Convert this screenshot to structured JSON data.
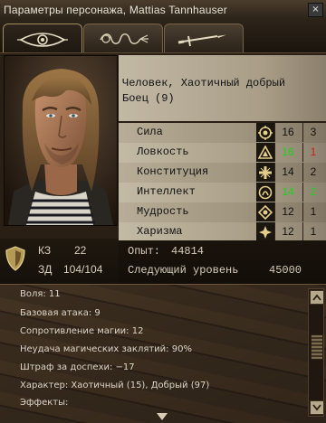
{
  "window": {
    "title": "Параметры персонажа, Mattias Tannhauser",
    "close_glyph": "×"
  },
  "tabs": [
    {
      "icon": "eye-icon",
      "active": true
    },
    {
      "icon": "rope-icon",
      "active": false
    },
    {
      "icon": "sword-icon",
      "active": false
    }
  ],
  "character": {
    "race_alignment": "Человек, Хаотичный добрый",
    "class_level": "Боец (9)"
  },
  "abilities": [
    {
      "name": "Сила",
      "icon": "strength-icon",
      "score": "16",
      "mod": "3",
      "score_color": "normal",
      "mod_color": "normal"
    },
    {
      "name": "Ловкость",
      "icon": "dexterity-icon",
      "score": "16",
      "mod": "1",
      "score_color": "green",
      "mod_color": "red"
    },
    {
      "name": "Конституция",
      "icon": "constitution-icon",
      "score": "14",
      "mod": "2",
      "score_color": "normal",
      "mod_color": "normal"
    },
    {
      "name": "Интеллект",
      "icon": "intelligence-icon",
      "score": "14",
      "mod": "2",
      "score_color": "green",
      "mod_color": "green"
    },
    {
      "name": "Мудрость",
      "icon": "wisdom-icon",
      "score": "12",
      "mod": "1",
      "score_color": "normal",
      "mod_color": "normal"
    },
    {
      "name": "Харизма",
      "icon": "charisma-icon",
      "score": "12",
      "mod": "1",
      "score_color": "normal",
      "mod_color": "normal"
    }
  ],
  "defense": {
    "ac_label": "КЗ",
    "ac_value": "22",
    "hp_label": "ЗД",
    "hp_value": "104/104"
  },
  "experience": {
    "xp_label": "Опыт:",
    "xp_value": "44814",
    "next_label": "Следующий уровень",
    "next_value": "45000"
  },
  "details": [
    "Воля: 11",
    "Базовая атака: 9",
    "Сопротивление магии: 12",
    "Неудача магических заклятий: 90%",
    "Штраф за доспехи: −17",
    "Характер: Хаотичный (15), Добрый (97)",
    "Эффекты:"
  ],
  "colors": {
    "bonus_green": "#1cd11c",
    "penalty_red": "#d11c1c"
  }
}
